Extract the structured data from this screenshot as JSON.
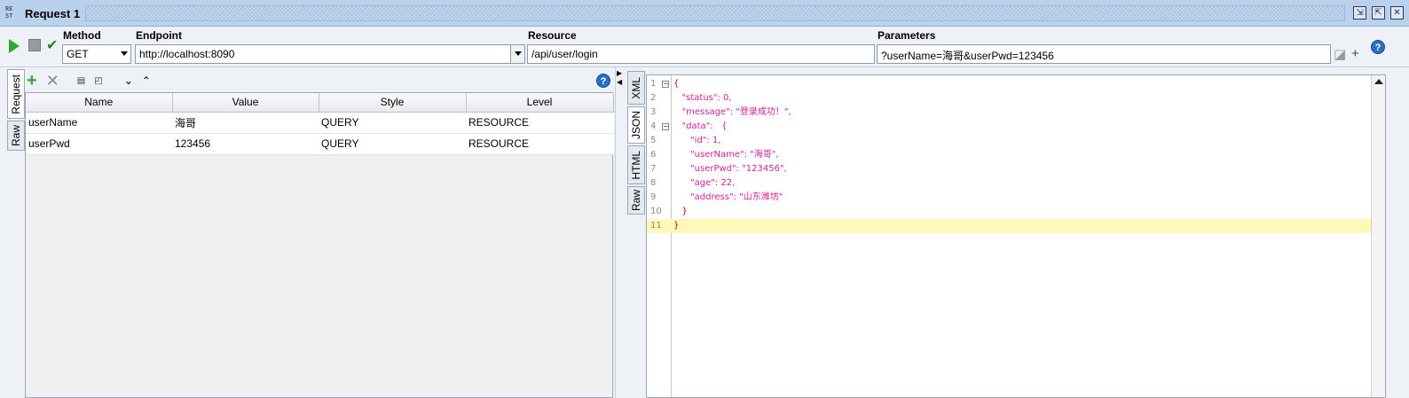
{
  "window": {
    "icon_text": "RE\nST",
    "title": "Request 1"
  },
  "toolbar": {
    "method_label": "Method",
    "method_value": "GET",
    "endpoint_label": "Endpoint",
    "endpoint_value": "http://localhost:8090",
    "resource_label": "Resource",
    "resource_value": "/api/user/login",
    "parameters_label": "Parameters",
    "parameters_value": "?userName=海哥&userPwd=123456",
    "help_glyph": "?"
  },
  "left_tabs": [
    "Request",
    "Raw"
  ],
  "params_table": {
    "columns": [
      "Name",
      "Value",
      "Style",
      "Level"
    ],
    "rows": [
      [
        "userName",
        "海哥",
        "QUERY",
        "RESOURCE"
      ],
      [
        "userPwd",
        "123456",
        "QUERY",
        "RESOURCE"
      ]
    ]
  },
  "right_tabs": [
    "XML",
    "JSON",
    "HTML",
    "Raw"
  ],
  "response": {
    "lines": [
      "{",
      "   \"status\": 0,",
      "   \"message\": \"登录成功！\",",
      "   \"data\":   {",
      "      \"id\": 1,",
      "      \"userName\": \"海哥\",",
      "      \"userPwd\": \"123456\",",
      "      \"age\": 22,",
      "      \"address\": \"山东潍坊\"",
      "   }",
      "}"
    ],
    "highlighted_line": 11
  }
}
